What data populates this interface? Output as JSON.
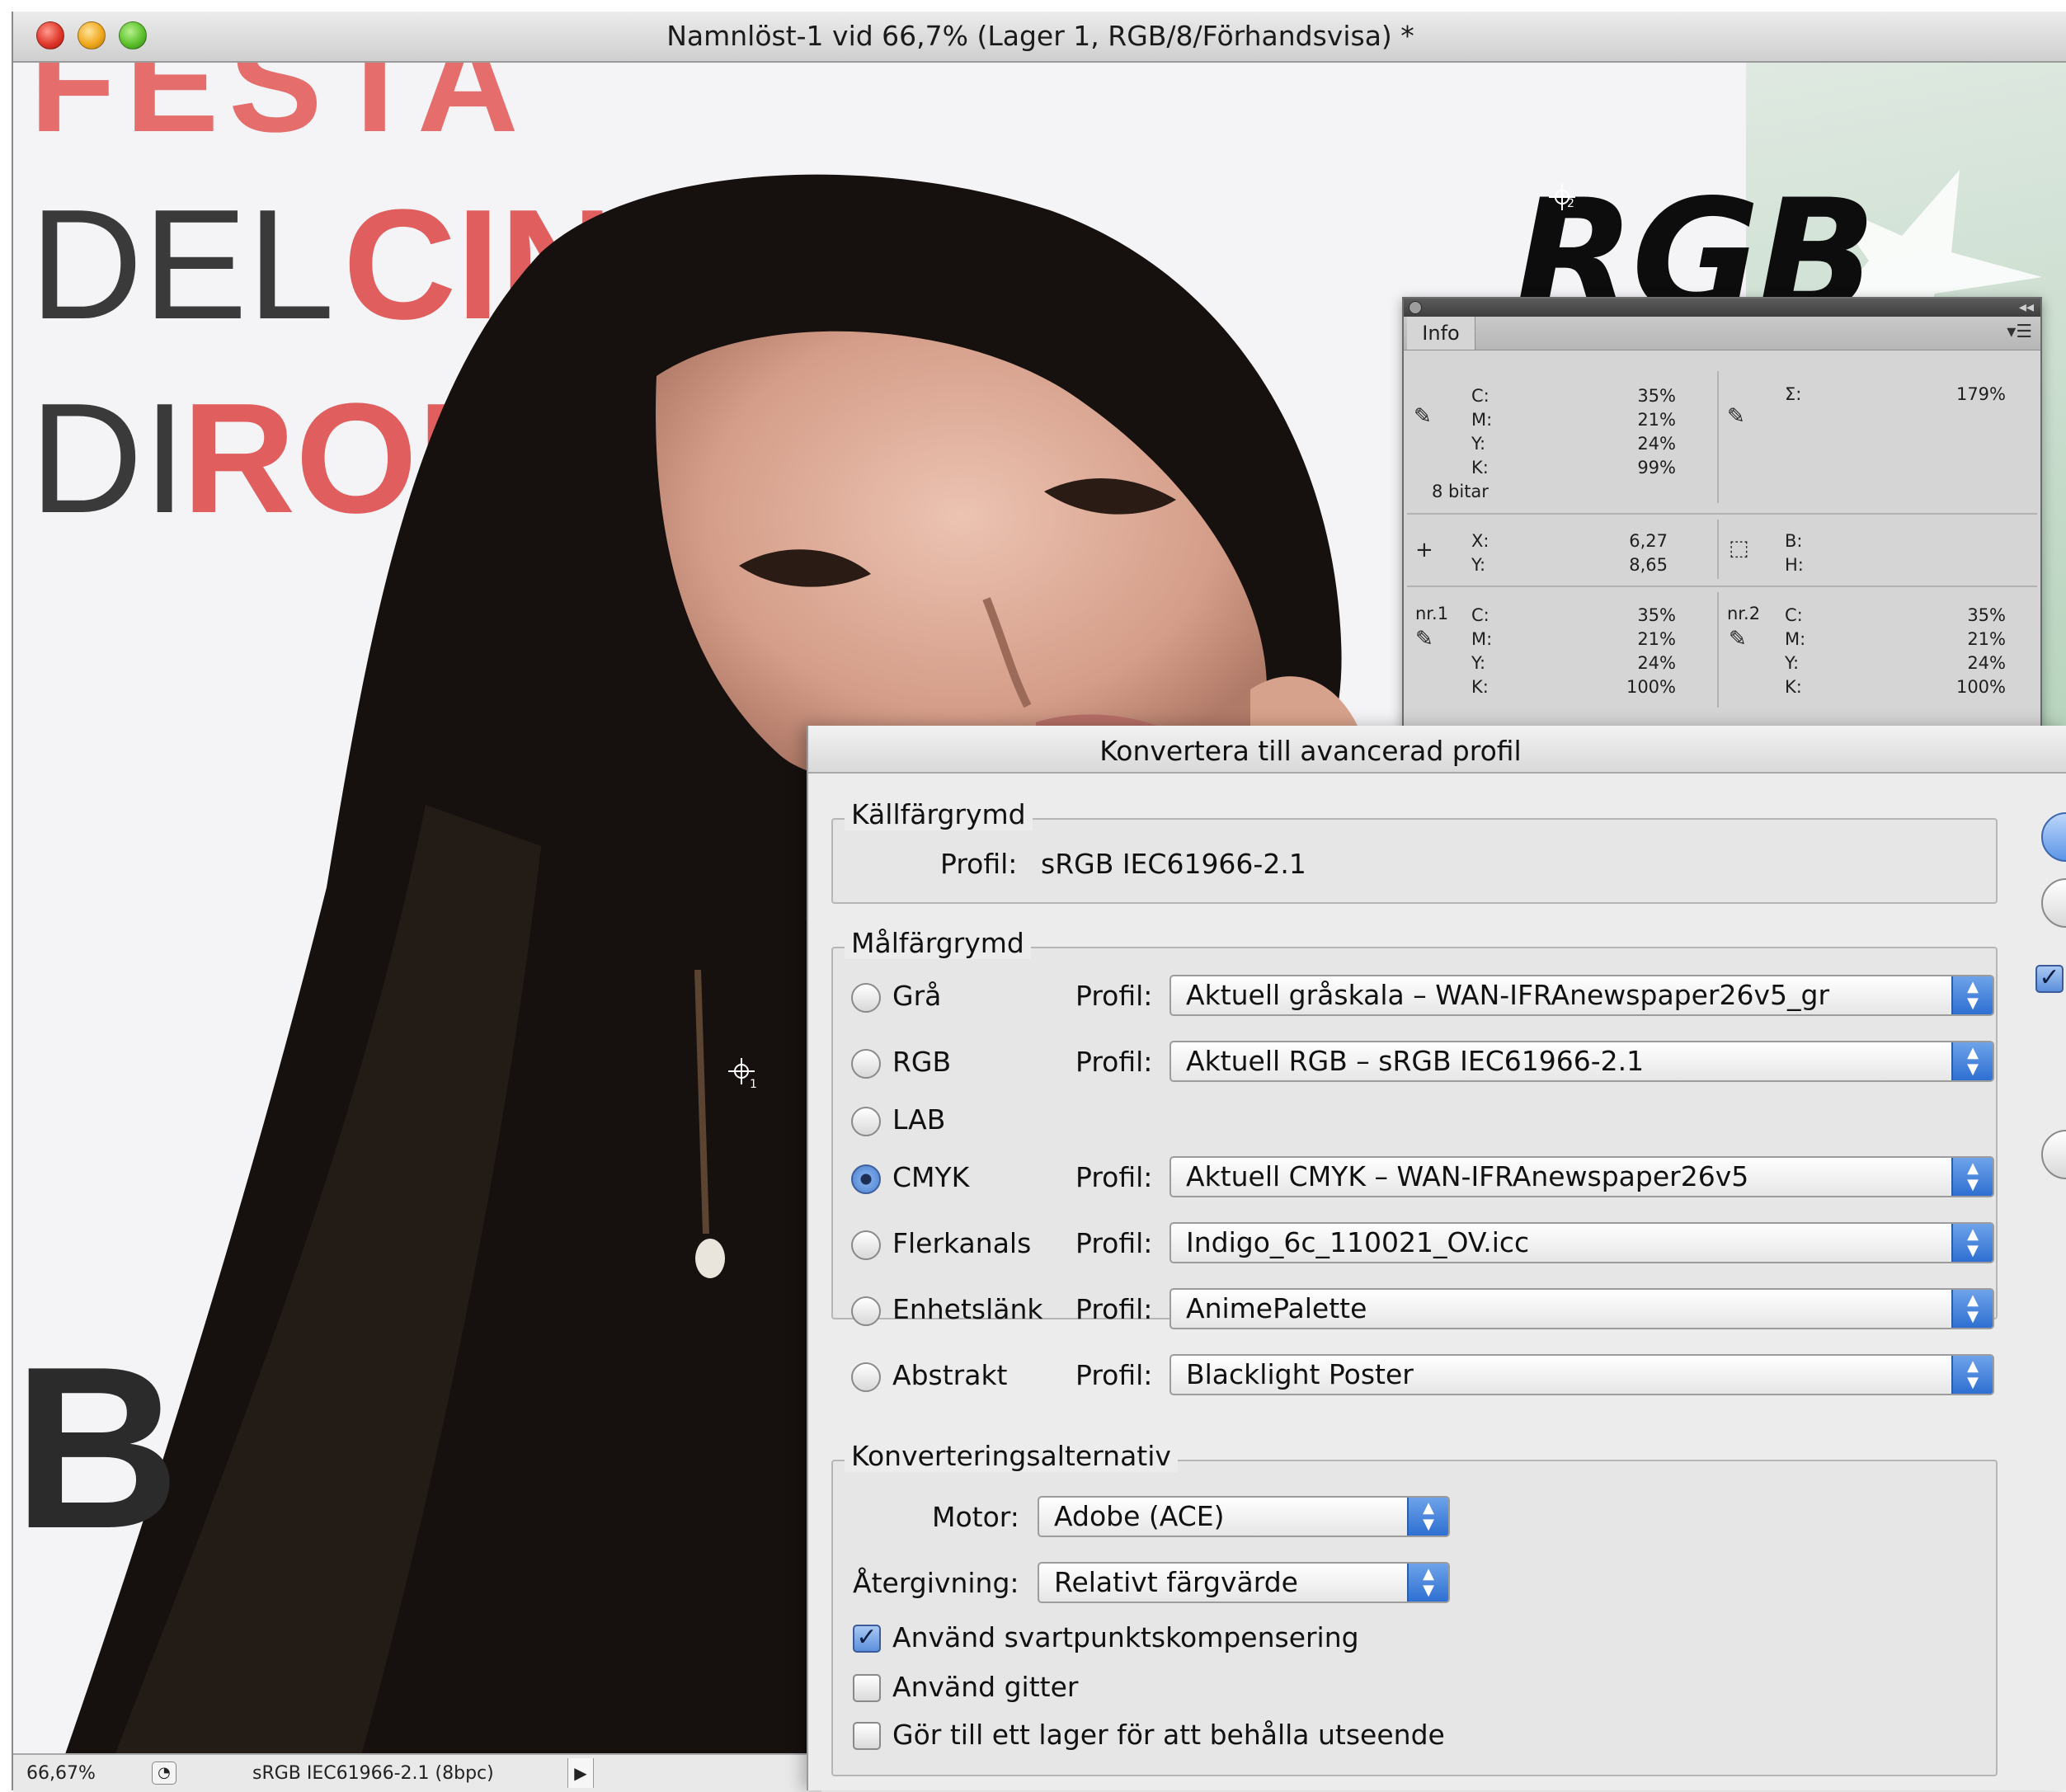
{
  "document": {
    "title": "Namnlöst-1 vid 66,7% (Lager 1, RGB/8/Förhandsvisa) *",
    "poster_text": {
      "festa": "FESTA",
      "del": "DEL",
      "cine": "CINE",
      "di": "DI",
      "roma": "ROM"
    },
    "overlay_label": "RGB",
    "status": {
      "zoom": "66,67%",
      "profile": "sRGB IEC61966-2.1 (8bpc)"
    },
    "samplers": [
      {
        "number": "1"
      },
      {
        "number": "2"
      }
    ]
  },
  "info_panel": {
    "tab": "Info",
    "top_left": {
      "labels": [
        "C:",
        "M:",
        "Y:",
        "K:"
      ],
      "values": [
        "35%",
        "21%",
        "24%",
        "99%"
      ],
      "bits": "8 bitar"
    },
    "top_right": {
      "label": "Σ:",
      "value": "179%"
    },
    "position": {
      "labels": [
        "X:",
        "Y:"
      ],
      "values": [
        "6,27",
        "8,65"
      ]
    },
    "size": {
      "labels": [
        "B:",
        "H:"
      ]
    },
    "sampler1": {
      "name": "nr.1",
      "labels": [
        "C:",
        "M:",
        "Y:",
        "K:"
      ],
      "values": [
        "35%",
        "21%",
        "24%",
        "100%"
      ]
    },
    "sampler2": {
      "name": "nr.2",
      "labels": [
        "C:",
        "M:",
        "Y:",
        "K:"
      ],
      "values": [
        "35%",
        "21%",
        "24%",
        "100%"
      ]
    }
  },
  "dialog": {
    "title": "Konvertera till avancerad profil",
    "source": {
      "legend": "Källfärgrymd",
      "profile_label": "Profil:",
      "profile_value": "sRGB IEC61966-2.1"
    },
    "target": {
      "legend": "Målfärgrymd",
      "profile_label": "Profil:",
      "options": [
        {
          "label": "Grå",
          "selected": false,
          "profile": "Aktuell gråskala – WAN-IFRAnewspaper26v5_gr"
        },
        {
          "label": "RGB",
          "selected": false,
          "profile": "Aktuell RGB – sRGB IEC61966-2.1"
        },
        {
          "label": "LAB",
          "selected": false,
          "profile": ""
        },
        {
          "label": "CMYK",
          "selected": true,
          "profile": "Aktuell CMYK – WAN-IFRAnewspaper26v5"
        },
        {
          "label": "Flerkanals",
          "selected": false,
          "profile": "Indigo_6c_110021_OV.icc"
        },
        {
          "label": "Enhetslänk",
          "selected": false,
          "profile": "AnimePalette"
        },
        {
          "label": "Abstrakt",
          "selected": false,
          "profile": "Blacklight Poster"
        }
      ]
    },
    "conversion": {
      "legend": "Konverteringsalternativ",
      "engine_label": "Motor:",
      "engine_value": "Adobe (ACE)",
      "intent_label": "Återgivning:",
      "intent_value": "Relativt färgvärde",
      "checkboxes": [
        {
          "label": "Använd svartpunktskompensering",
          "checked": true
        },
        {
          "label": "Använd gitter",
          "checked": false
        },
        {
          "label": "Gör till ett lager för att behålla utseende",
          "checked": false
        }
      ]
    }
  },
  "colors": {
    "accent_blue": "#4c7fcc",
    "poster_red": "#e05f5e",
    "hair": "#1a1512",
    "skin": "#dba995"
  }
}
